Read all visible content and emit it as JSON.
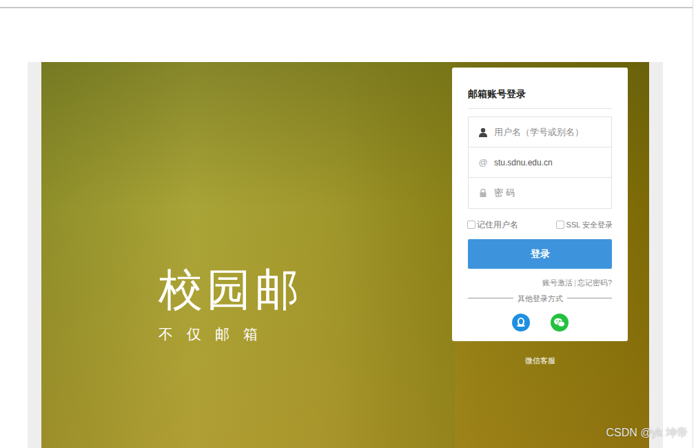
{
  "brand": {
    "logo": "校园邮",
    "slogan": "不 仅 邮 箱"
  },
  "login": {
    "title": "邮箱账号登录",
    "username_placeholder": "用户名（学号或别名）",
    "at_symbol": "@",
    "domain": "stu.sdnu.edu.cn",
    "password_placeholder": "密 码",
    "remember": {
      "label": "记住用户名",
      "checked": false
    },
    "ssl": {
      "label": "SSL 安全登录",
      "checked": false
    },
    "submit": "登录",
    "links": [
      "账号激活",
      "忘记密码?"
    ],
    "separator": "|",
    "other_title": "其他登录方式"
  },
  "support": "微信客服",
  "watermark": "CSDN @yk 坤帝"
}
